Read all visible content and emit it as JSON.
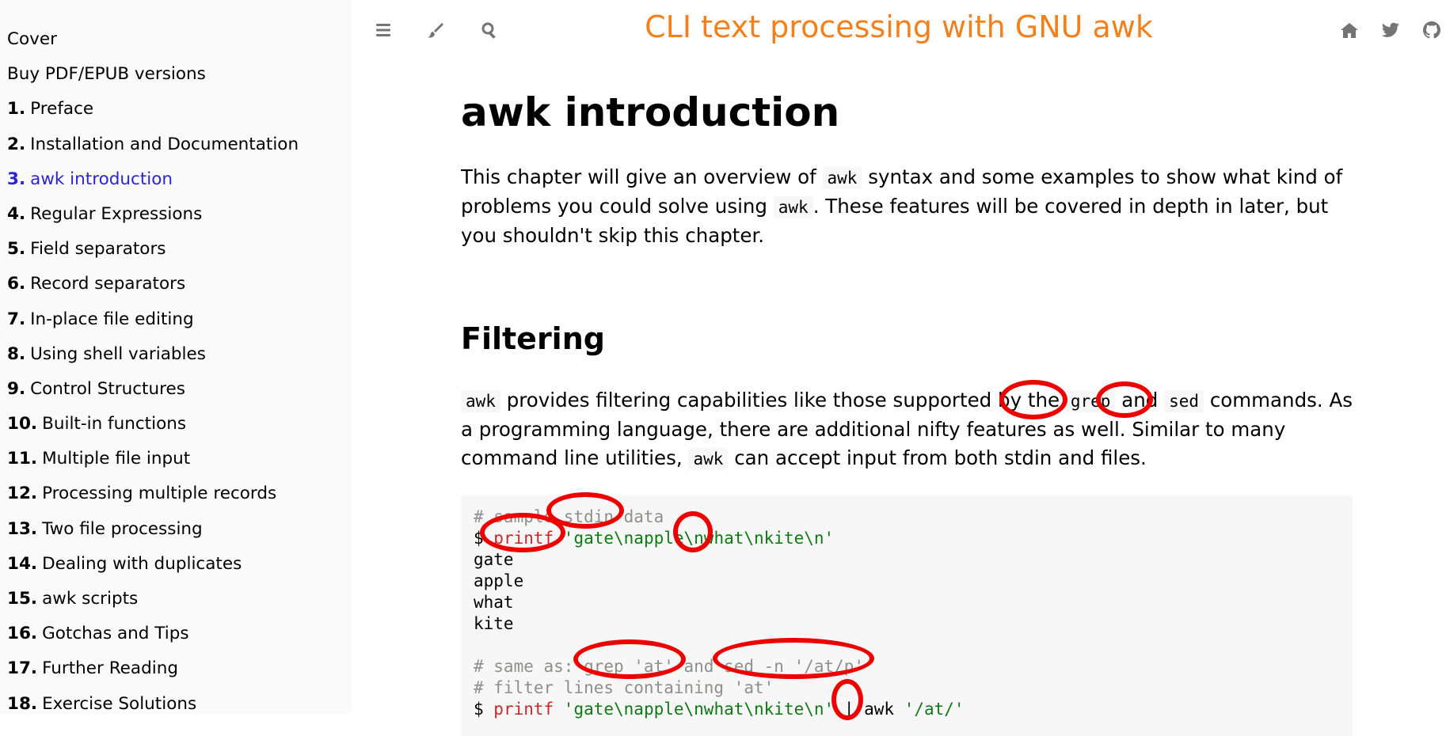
{
  "sidebar": {
    "items": [
      {
        "num": "",
        "label": "Cover"
      },
      {
        "num": "",
        "label": "Buy PDF/EPUB versions"
      },
      {
        "num": "1.",
        "label": "Preface"
      },
      {
        "num": "2.",
        "label": "Installation and Documentation"
      },
      {
        "num": "3.",
        "label": "awk introduction",
        "active": true
      },
      {
        "num": "4.",
        "label": "Regular Expressions"
      },
      {
        "num": "5.",
        "label": "Field separators"
      },
      {
        "num": "6.",
        "label": "Record separators"
      },
      {
        "num": "7.",
        "label": "In-place file editing"
      },
      {
        "num": "8.",
        "label": "Using shell variables"
      },
      {
        "num": "9.",
        "label": "Control Structures"
      },
      {
        "num": "10.",
        "label": "Built-in functions"
      },
      {
        "num": "11.",
        "label": "Multiple file input"
      },
      {
        "num": "12.",
        "label": "Processing multiple records"
      },
      {
        "num": "13.",
        "label": "Two file processing"
      },
      {
        "num": "14.",
        "label": "Dealing with duplicates"
      },
      {
        "num": "15.",
        "label": "awk scripts"
      },
      {
        "num": "16.",
        "label": "Gotchas and Tips"
      },
      {
        "num": "17.",
        "label": "Further Reading"
      },
      {
        "num": "18.",
        "label": "Exercise Solutions"
      }
    ]
  },
  "menubar": {
    "title": "CLI text processing with GNU awk",
    "left_icons": [
      "bars-icon",
      "paintbrush-icon",
      "search-icon"
    ],
    "right_icons": [
      "home-icon",
      "twitter-icon",
      "github-icon"
    ]
  },
  "main": {
    "page_title": "awk introduction",
    "intro": {
      "t1": "This chapter will give an overview of ",
      "c1": "awk",
      "t2": " syntax and some examples to show what kind of problems you could solve using ",
      "c2": "awk",
      "t3": ". These features will be covered in depth in later, but you shouldn't skip this chapter."
    },
    "section_title": "Filtering",
    "filter_para": {
      "c1": "awk",
      "t1": " provides filtering capabilities like those supported by the ",
      "c2": "grep",
      "t2": " and ",
      "c3": "sed",
      "t3": " commands. As a programming language, there are additional nifty features as well. Similar to many command line utilities, ",
      "c4": "awk",
      "t4": " can accept input from both stdin and files."
    },
    "code": {
      "l1": "# sample stdin data",
      "l2_prompt": "$ ",
      "l2_cmd": "printf",
      "l2_str": " 'gate\\napple\\nwhat\\nkite\\n'",
      "out1": "gate",
      "out2": "apple",
      "out3": "what",
      "out4": "kite",
      "l3": "# same as: grep 'at' and sed -n '/at/p'",
      "l4": "# filter lines containing 'at'",
      "l5_prompt": "$ ",
      "l5_cmd": "printf",
      "l5_str": " 'gate\\napple\\nwhat\\nkite\\n'",
      "l5_pipe": " | ",
      "l5_awk": "awk ",
      "l5_prog": "'/at/'"
    }
  },
  "colors": {
    "title": "#f4801c",
    "active_link": "#2a24d6",
    "annotation": "#ee0000"
  }
}
